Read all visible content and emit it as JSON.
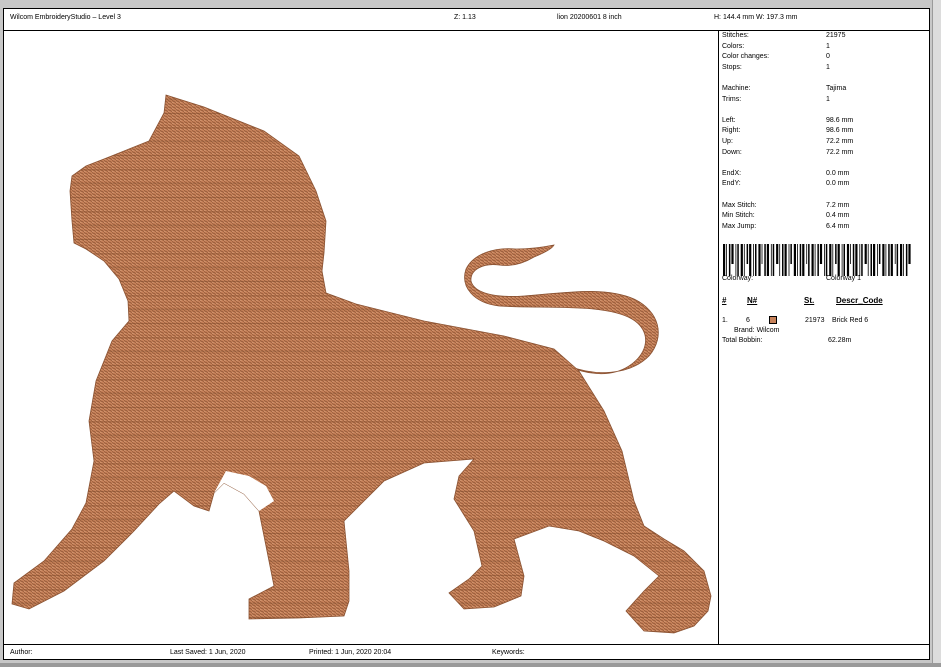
{
  "header": {
    "app_title": "Wilcom EmbroideryStudio – Level 3",
    "zoom": "Z: 1.13",
    "filename": "lion 20200601 8 inch",
    "size": "H: 144.4 mm   W: 197.3 mm"
  },
  "stats": {
    "stitches_label": "Stitches:",
    "stitches": "21975",
    "colors_label": "Colors:",
    "colors": "1",
    "color_changes_label": "Color changes:",
    "color_changes": "0",
    "stops_label": "Stops:",
    "stops": "1",
    "machine_label": "Machine:",
    "machine": "Tajima",
    "trims_label": "Trims:",
    "trims": "1",
    "left_label": "Left:",
    "left": "98.6 mm",
    "right_label": "Right:",
    "right": "98.6 mm",
    "up_label": "Up:",
    "up": "72.2 mm",
    "down_label": "Down:",
    "down": "72.2 mm",
    "endx_label": "EndX:",
    "endx": "0.0 mm",
    "endy_label": "EndY:",
    "endy": "0.0 mm",
    "max_stitch_label": "Max Stitch:",
    "max_stitch": "7.2 mm",
    "min_stitch_label": "Min Stitch:",
    "min_stitch": "0.4 mm",
    "max_jump_label": "Max Jump:",
    "max_jump": "6.4 mm"
  },
  "colorway": {
    "label": "Colorway:",
    "value": "Colorway 1"
  },
  "color_table": {
    "headers": [
      "#",
      "N#",
      "St.",
      "Descr_Code"
    ],
    "rows": [
      {
        "index": "1.",
        "n": "6",
        "stitches": "21973",
        "descr": "Brick Red 6",
        "brand": "Brand: Wilcom",
        "color": "#c7825a"
      }
    ],
    "total_bobbin_label": "Total Bobbin:",
    "total_bobbin": "62.28m"
  },
  "footer": {
    "author": "Author:",
    "last_saved": "Last Saved:  1 Jun, 2020",
    "printed": "Printed:  1 Jun, 2020 20:04",
    "keywords": "Keywords:"
  },
  "colors": {
    "thread": "#c7825a",
    "thread_dark": "#8a5232"
  }
}
